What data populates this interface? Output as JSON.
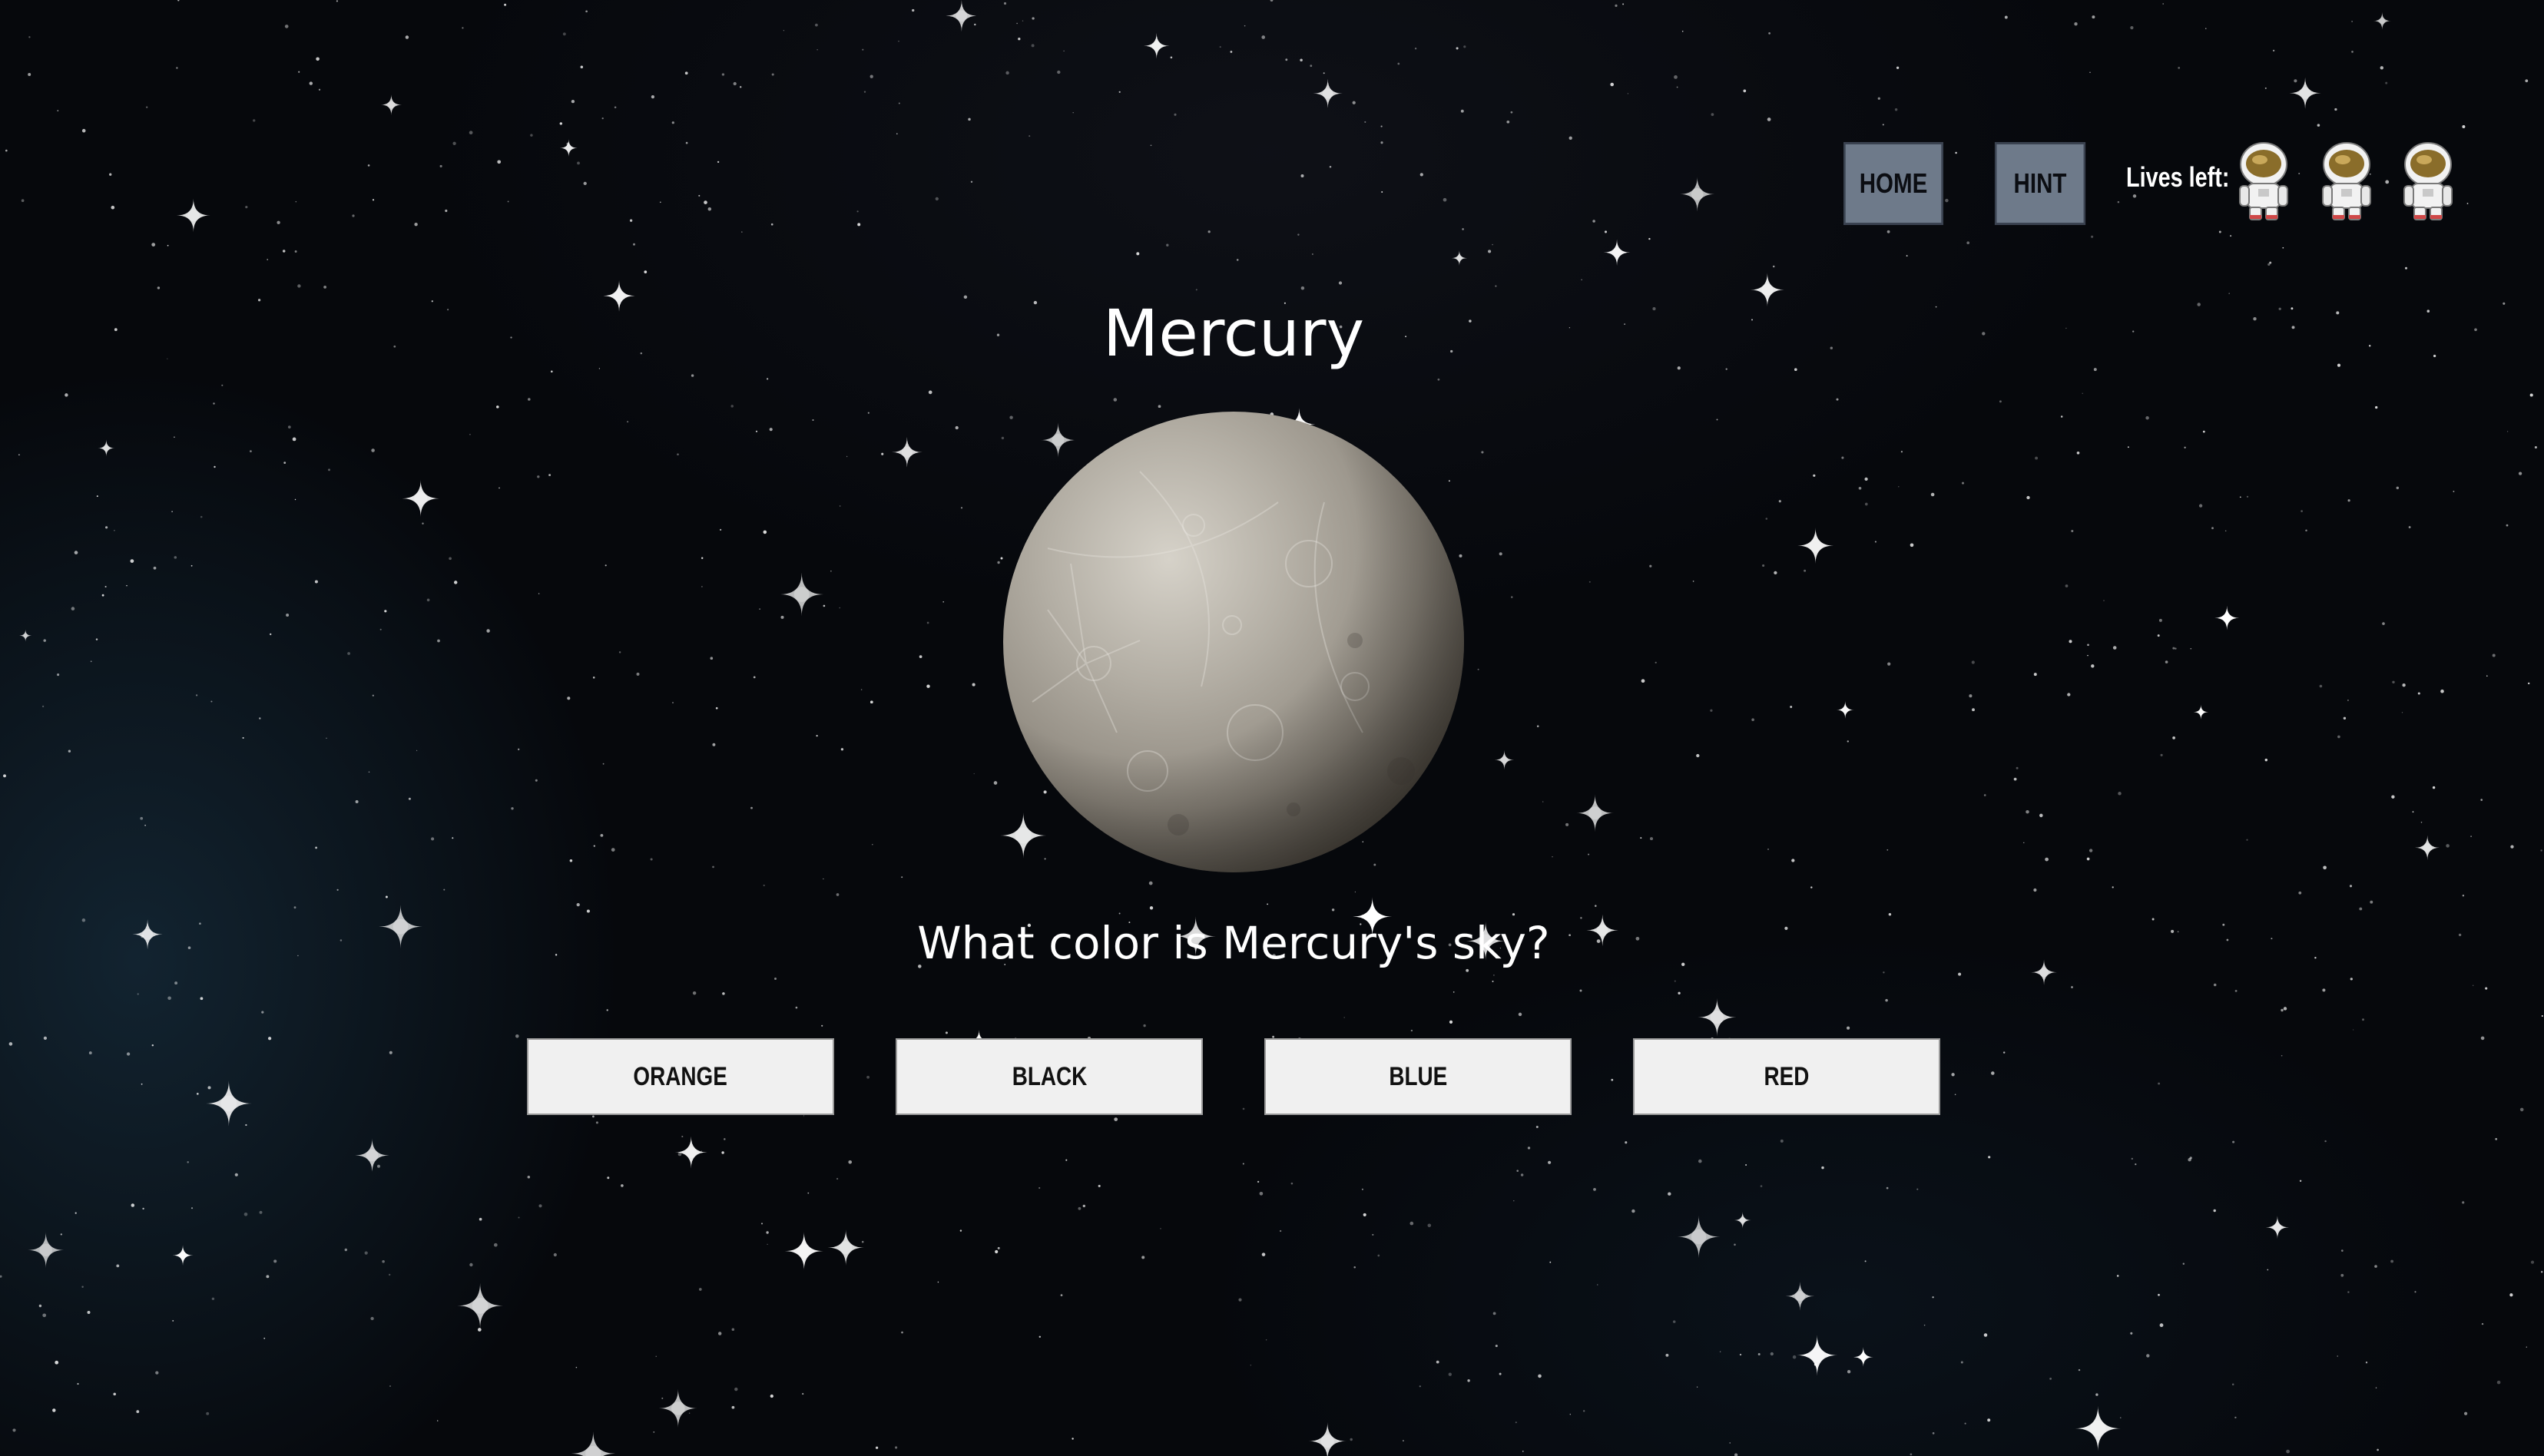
{
  "nav": {
    "home_label": "HOME",
    "hint_label": "HINT"
  },
  "lives": {
    "label": "Lives left:",
    "remaining": 3,
    "icon": "astronaut-icon"
  },
  "planet": {
    "name": "Mercury",
    "icon": "mercury-planet-image"
  },
  "question": "What color is Mercury's sky?",
  "answers": [
    "ORANGE",
    "BLACK",
    "BLUE",
    "RED"
  ],
  "colors": {
    "background": "#06080c",
    "nav_button": "#6e7a8a",
    "answer_button": "#f0f0f0",
    "text": "#ffffff"
  }
}
